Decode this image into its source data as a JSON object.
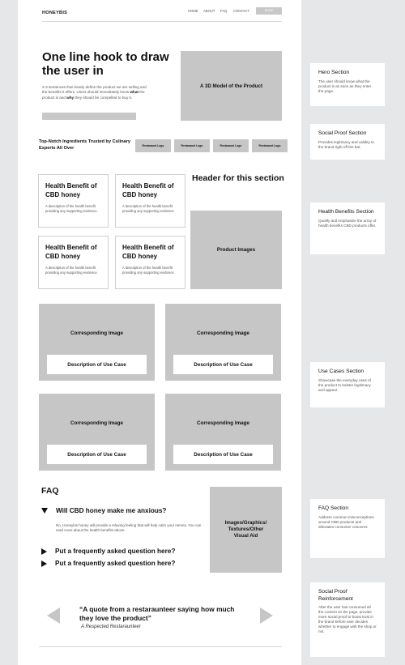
{
  "header": {
    "logo": "HONEYBIS",
    "nav": [
      "HOME",
      "ABOUT",
      "FAQ",
      "CONTACT"
    ],
    "shop": "SHOP"
  },
  "hero": {
    "title": "One line hook to draw the user in",
    "desc_pre": "2-3 sentences that clearly define the product we are selling and the benefits it offers. Users should immediately know ",
    "desc_what": "what",
    "desc_mid": " the product is and ",
    "desc_why": "why",
    "desc_post": " they should be compelled to buy it.",
    "image": "A 3D Model of the Product"
  },
  "social_proof": {
    "text": "Top-Notch Ingredients Trusted by Culinary Experts All Over",
    "logos": [
      "Restaraunt Logo",
      "Restaraunt Logo",
      "Restaraunt Logo",
      "Restaraunt Logo"
    ]
  },
  "benefits": {
    "header": "Header for this section",
    "product_images": "Product Images",
    "cards": [
      {
        "title": "Health Benefit of CBD honey",
        "desc": "A description of the health benefit providing any supporting evidence."
      },
      {
        "title": "Health Benefit of CBD honey",
        "desc": "A description of the health benefit providing any supporting evidence."
      },
      {
        "title": "Health Benefit of CBD honey",
        "desc": "A description of the health benefit providing any supporting evidence."
      },
      {
        "title": "Health Benefit of CBD honey",
        "desc": "A description of the health benefit providing any supporting evidence."
      }
    ]
  },
  "use_cases": [
    {
      "image": "Corresponding Image",
      "desc": "Description of Use Case"
    },
    {
      "image": "Corresponding Image",
      "desc": "Description of Use Case"
    },
    {
      "image": "Corresponding Image",
      "desc": "Description of Use Case"
    },
    {
      "image": "Corresponding Image",
      "desc": "Description of Use Case"
    }
  ],
  "faq": {
    "title": "FAQ",
    "q1": "Will CBD honey make me anxious?",
    "a1": "No, Honeybis honey will provide a relaxing feeling that will help calm your nerves. You can read more about the health benefits above.",
    "q2": "Put a frequently asked question here?",
    "q3": "Put a frequently asked question here?",
    "image": "Images/Graphics/ Textures/Other Visual Aid"
  },
  "testimonial": {
    "quote": "“A quote from a restaraunteer saying how much they love the product”",
    "author": "A Respected Restaraunteer"
  },
  "notes": [
    {
      "title": "Hero Section",
      "desc": "The user should know what the product is as soon as they enter the page."
    },
    {
      "title": "Social Proof Section",
      "desc": "Provides legitimacy and validity to the brand right off the bat."
    },
    {
      "title": "Health Benefits Section",
      "desc": "Qualify and emphasize the array of health benefits CBD products offer."
    },
    {
      "title": "Use Cases Section",
      "desc": "Showcase the everyday uses of the product to bolster legitimacy and appeal."
    },
    {
      "title": "FAQ Section",
      "desc": "Address common misconceptions around CBD products and alleviates consumer concerns"
    },
    {
      "title": "Social Proof Reinforcement",
      "desc": "After the user has consumed all the content on the page, provide more social proof to boost trust in the brand before user decides whether to engage with the shop or not."
    }
  ]
}
